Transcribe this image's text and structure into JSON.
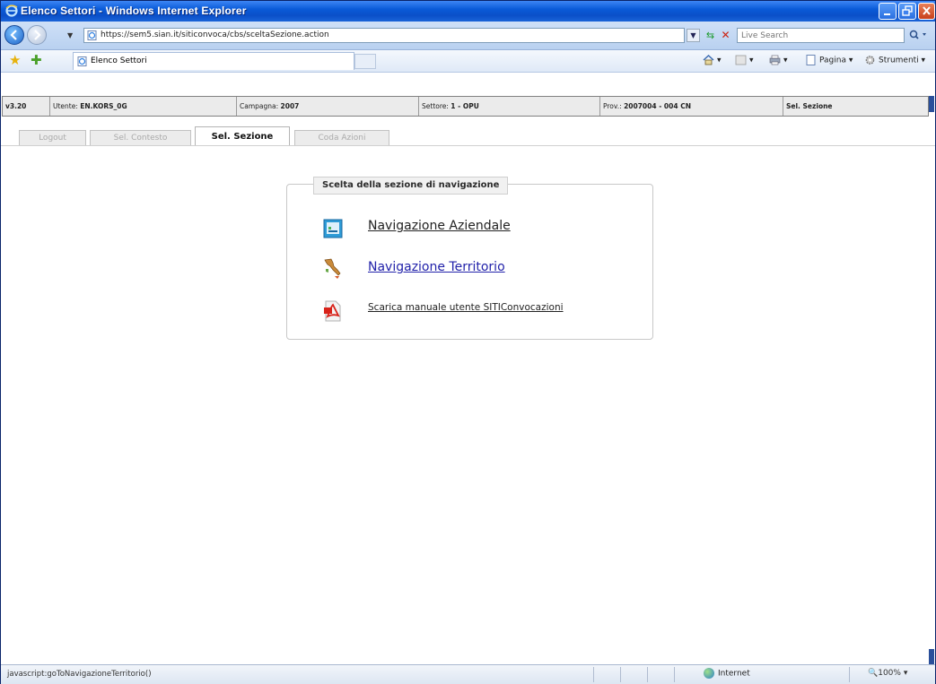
{
  "window": {
    "title": "Elenco Settori - Windows Internet Explorer"
  },
  "browser": {
    "url": "https://sem5.sian.it/siticonvoca/cbs/sceltaSezione.action",
    "search_placeholder": "Live Search",
    "tab_title": "Elenco Settori",
    "commands": {
      "page": "Pagina",
      "tools": "Strumenti"
    }
  },
  "app_header": {
    "version": "v3.20",
    "user_label": "Utente:",
    "user_value": "EN.KORS_0G",
    "campaign_label": "Campagna:",
    "campaign_value": "2007",
    "sector_label": "Settore:",
    "sector_value": "1 - OPU",
    "province_label": "Prov.:",
    "province_value": "2007004 - 004 CN",
    "section": "Sel. Sezione"
  },
  "tabs": [
    {
      "label": "Logout",
      "active": false
    },
    {
      "label": "Sel. Contesto",
      "active": false
    },
    {
      "label": "Sel. Sezione",
      "active": true
    },
    {
      "label": "Coda Azioni",
      "active": false
    }
  ],
  "panel": {
    "title": "Scelta della sezione di navigazione",
    "items": [
      {
        "label": "Navigazione Aziendale",
        "icon": "company-navigation-icon"
      },
      {
        "label": "Navigazione Territorio",
        "icon": "italy-map-icon"
      },
      {
        "label": "Scarica manuale utente SITIConvocazioni",
        "icon": "pdf-icon"
      }
    ]
  },
  "status": {
    "text": "javascript:goToNavigazioneTerritorio()",
    "zone": "Internet",
    "zoom": "100%"
  },
  "colors": {
    "titlebar": "#0a5bd8",
    "link": "#2222aa",
    "scroll_thumb": "#2a4f9a"
  }
}
